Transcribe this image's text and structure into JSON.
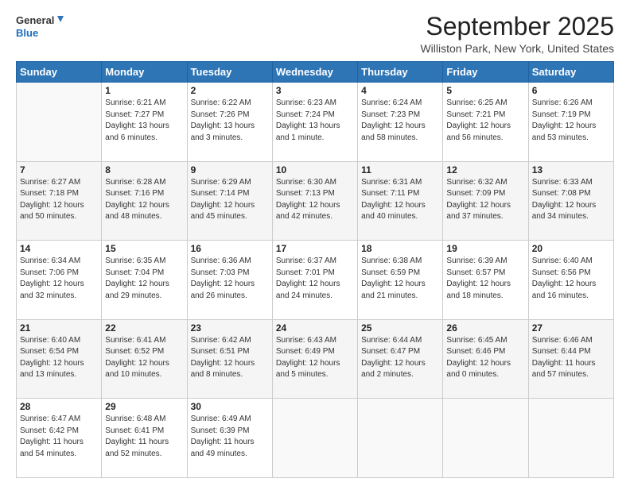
{
  "header": {
    "logo_line1": "General",
    "logo_line2": "Blue",
    "month": "September 2025",
    "location": "Williston Park, New York, United States"
  },
  "days_of_week": [
    "Sunday",
    "Monday",
    "Tuesday",
    "Wednesday",
    "Thursday",
    "Friday",
    "Saturday"
  ],
  "weeks": [
    [
      {
        "day": "",
        "sunrise": "",
        "sunset": "",
        "daylight": ""
      },
      {
        "day": "1",
        "sunrise": "6:21 AM",
        "sunset": "7:27 PM",
        "daylight": "13 hours and 6 minutes."
      },
      {
        "day": "2",
        "sunrise": "6:22 AM",
        "sunset": "7:26 PM",
        "daylight": "13 hours and 3 minutes."
      },
      {
        "day": "3",
        "sunrise": "6:23 AM",
        "sunset": "7:24 PM",
        "daylight": "13 hours and 1 minute."
      },
      {
        "day": "4",
        "sunrise": "6:24 AM",
        "sunset": "7:23 PM",
        "daylight": "12 hours and 58 minutes."
      },
      {
        "day": "5",
        "sunrise": "6:25 AM",
        "sunset": "7:21 PM",
        "daylight": "12 hours and 56 minutes."
      },
      {
        "day": "6",
        "sunrise": "6:26 AM",
        "sunset": "7:19 PM",
        "daylight": "12 hours and 53 minutes."
      }
    ],
    [
      {
        "day": "7",
        "sunrise": "6:27 AM",
        "sunset": "7:18 PM",
        "daylight": "12 hours and 50 minutes."
      },
      {
        "day": "8",
        "sunrise": "6:28 AM",
        "sunset": "7:16 PM",
        "daylight": "12 hours and 48 minutes."
      },
      {
        "day": "9",
        "sunrise": "6:29 AM",
        "sunset": "7:14 PM",
        "daylight": "12 hours and 45 minutes."
      },
      {
        "day": "10",
        "sunrise": "6:30 AM",
        "sunset": "7:13 PM",
        "daylight": "12 hours and 42 minutes."
      },
      {
        "day": "11",
        "sunrise": "6:31 AM",
        "sunset": "7:11 PM",
        "daylight": "12 hours and 40 minutes."
      },
      {
        "day": "12",
        "sunrise": "6:32 AM",
        "sunset": "7:09 PM",
        "daylight": "12 hours and 37 minutes."
      },
      {
        "day": "13",
        "sunrise": "6:33 AM",
        "sunset": "7:08 PM",
        "daylight": "12 hours and 34 minutes."
      }
    ],
    [
      {
        "day": "14",
        "sunrise": "6:34 AM",
        "sunset": "7:06 PM",
        "daylight": "12 hours and 32 minutes."
      },
      {
        "day": "15",
        "sunrise": "6:35 AM",
        "sunset": "7:04 PM",
        "daylight": "12 hours and 29 minutes."
      },
      {
        "day": "16",
        "sunrise": "6:36 AM",
        "sunset": "7:03 PM",
        "daylight": "12 hours and 26 minutes."
      },
      {
        "day": "17",
        "sunrise": "6:37 AM",
        "sunset": "7:01 PM",
        "daylight": "12 hours and 24 minutes."
      },
      {
        "day": "18",
        "sunrise": "6:38 AM",
        "sunset": "6:59 PM",
        "daylight": "12 hours and 21 minutes."
      },
      {
        "day": "19",
        "sunrise": "6:39 AM",
        "sunset": "6:57 PM",
        "daylight": "12 hours and 18 minutes."
      },
      {
        "day": "20",
        "sunrise": "6:40 AM",
        "sunset": "6:56 PM",
        "daylight": "12 hours and 16 minutes."
      }
    ],
    [
      {
        "day": "21",
        "sunrise": "6:40 AM",
        "sunset": "6:54 PM",
        "daylight": "12 hours and 13 minutes."
      },
      {
        "day": "22",
        "sunrise": "6:41 AM",
        "sunset": "6:52 PM",
        "daylight": "12 hours and 10 minutes."
      },
      {
        "day": "23",
        "sunrise": "6:42 AM",
        "sunset": "6:51 PM",
        "daylight": "12 hours and 8 minutes."
      },
      {
        "day": "24",
        "sunrise": "6:43 AM",
        "sunset": "6:49 PM",
        "daylight": "12 hours and 5 minutes."
      },
      {
        "day": "25",
        "sunrise": "6:44 AM",
        "sunset": "6:47 PM",
        "daylight": "12 hours and 2 minutes."
      },
      {
        "day": "26",
        "sunrise": "6:45 AM",
        "sunset": "6:46 PM",
        "daylight": "12 hours and 0 minutes."
      },
      {
        "day": "27",
        "sunrise": "6:46 AM",
        "sunset": "6:44 PM",
        "daylight": "11 hours and 57 minutes."
      }
    ],
    [
      {
        "day": "28",
        "sunrise": "6:47 AM",
        "sunset": "6:42 PM",
        "daylight": "11 hours and 54 minutes."
      },
      {
        "day": "29",
        "sunrise": "6:48 AM",
        "sunset": "6:41 PM",
        "daylight": "11 hours and 52 minutes."
      },
      {
        "day": "30",
        "sunrise": "6:49 AM",
        "sunset": "6:39 PM",
        "daylight": "11 hours and 49 minutes."
      },
      {
        "day": "",
        "sunrise": "",
        "sunset": "",
        "daylight": ""
      },
      {
        "day": "",
        "sunrise": "",
        "sunset": "",
        "daylight": ""
      },
      {
        "day": "",
        "sunrise": "",
        "sunset": "",
        "daylight": ""
      },
      {
        "day": "",
        "sunrise": "",
        "sunset": "",
        "daylight": ""
      }
    ]
  ]
}
